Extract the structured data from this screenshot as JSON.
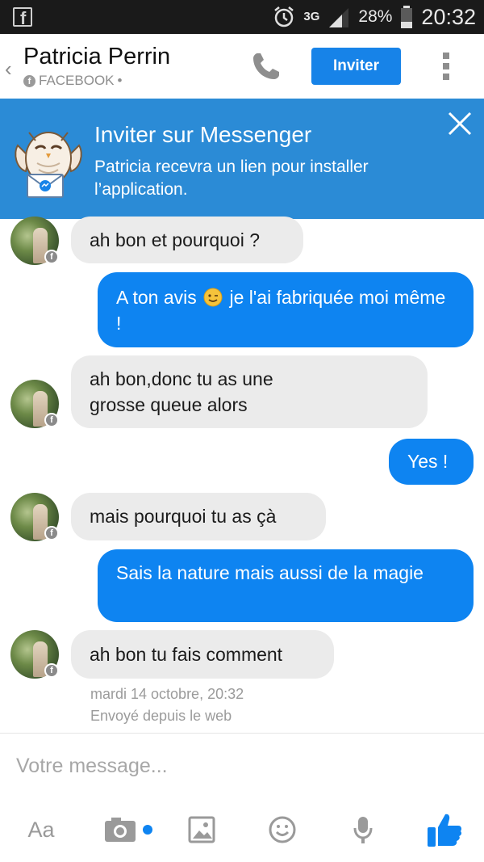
{
  "status_bar": {
    "network": "3G",
    "battery_percent": "28%",
    "time": "20:32"
  },
  "header": {
    "contact_name": "Patricia Perrin",
    "source_label": "FACEBOOK",
    "source_suffix": "•",
    "invite_button": "Inviter"
  },
  "banner": {
    "title": "Inviter sur Messenger",
    "description": "Patricia recevra un lien pour installer l’application."
  },
  "messages": [
    {
      "direction": "incoming",
      "text": "ah bon et pourquoi ?"
    },
    {
      "direction": "outgoing",
      "text_before_emoji": "A ton avis",
      "text_after_emoji": "je l'ai fabriquée moi même !"
    },
    {
      "direction": "incoming",
      "text": "ah bon,donc tu as une grosse queue alors"
    },
    {
      "direction": "outgoing",
      "text": "Yes !"
    },
    {
      "direction": "incoming",
      "text": "mais pourquoi tu as çà"
    },
    {
      "direction": "outgoing",
      "text": "Sais la nature mais aussi de la magie"
    },
    {
      "direction": "incoming",
      "text": "ah bon tu fais comment"
    }
  ],
  "last_message_meta": {
    "timestamp": "mardi 14 octobre, 20:32",
    "sent_via": "Envoyé depuis le web"
  },
  "composer": {
    "placeholder": "Votre message...",
    "text_format_label": "Aa"
  },
  "colors": {
    "accent": "#0e84f1",
    "banner": "#2b8bd6",
    "incoming_bubble": "#ebebeb"
  }
}
